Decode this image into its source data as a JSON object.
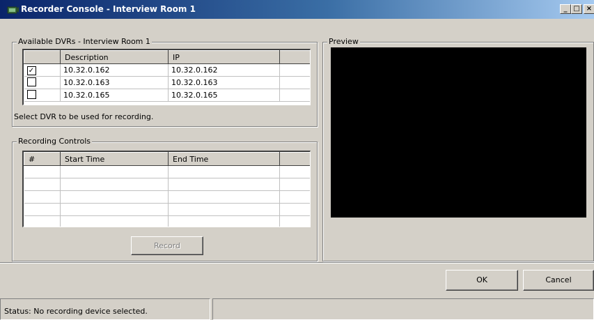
{
  "window": {
    "title": "Recorder Console - Interview Room 1",
    "controls": {
      "minimize": "_",
      "maximize": "□",
      "close": "×"
    }
  },
  "dvr_group": {
    "legend": "Available DVRs - Interview Room 1",
    "columns": [
      "",
      "Description",
      "IP",
      ""
    ],
    "rows": [
      {
        "checked": true,
        "description": "10.32.0.162",
        "ip": "10.32.0.162"
      },
      {
        "checked": false,
        "description": "10.32.0.163",
        "ip": "10.32.0.163"
      },
      {
        "checked": false,
        "description": "10.32.0.165",
        "ip": "10.32.0.165"
      }
    ],
    "hint": "Select DVR to be used for recording."
  },
  "recording_group": {
    "legend": "Recording Controls",
    "columns": [
      "#",
      "Start Time",
      "End Time",
      ""
    ],
    "record_label": "Record"
  },
  "preview_group": {
    "legend": "Preview"
  },
  "buttons": {
    "ok": "OK",
    "cancel": "Cancel"
  },
  "status": {
    "text": "Status: No recording device selected.",
    "secondary": ""
  },
  "icons": {
    "app": "recorder-app-icon",
    "check": "✓"
  }
}
